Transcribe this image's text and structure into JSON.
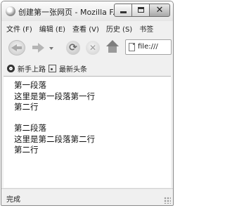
{
  "window": {
    "title": "创建第一张网页 - Mozilla F..."
  },
  "menu": [
    {
      "label": "文件 (F)"
    },
    {
      "label": "编辑 (E)"
    },
    {
      "label": "查看 (V)"
    },
    {
      "label": "历史 (S)"
    },
    {
      "label": "书签"
    }
  ],
  "toolbar": {
    "icons": [
      "back-arrow",
      "forward-arrow",
      "dropdown",
      "reload",
      "stop",
      "home"
    ],
    "url": "file:///"
  },
  "bookmarks": [
    {
      "label": "新手上路",
      "icon": "gear"
    },
    {
      "label": "最新头条",
      "icon": "rss"
    }
  ],
  "content": {
    "paragraphs": [
      {
        "lines": [
          "第一段落",
          "这里是第一段落第一行",
          "第二行"
        ]
      },
      {
        "lines": [
          "第二段落",
          "这里是第二段落第二行",
          "第二行"
        ]
      }
    ]
  },
  "status": {
    "text": "完成"
  }
}
